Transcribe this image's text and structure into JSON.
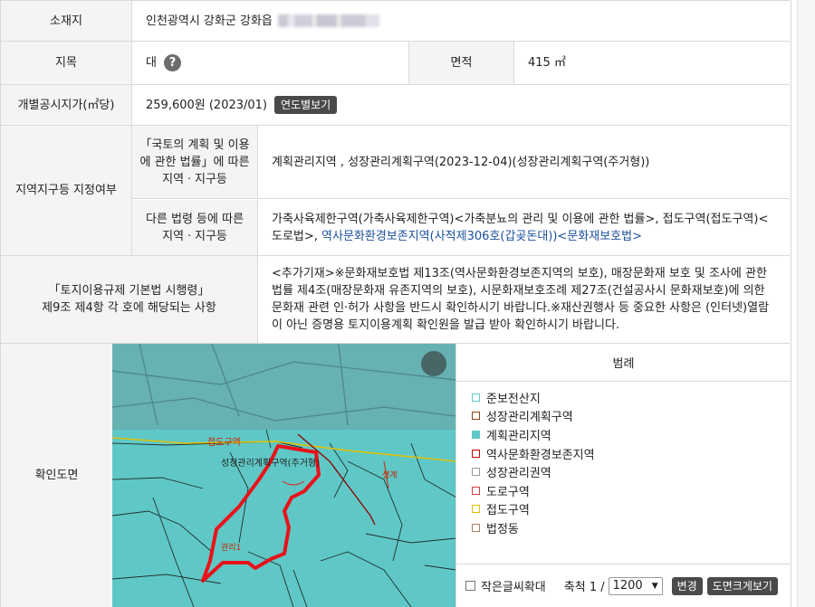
{
  "location": {
    "label": "소재지",
    "value": "인천광역시 강화군 강화읍"
  },
  "land_category": {
    "label": "지목",
    "value": "대",
    "help": "?"
  },
  "area": {
    "label": "면적",
    "value": "415 ㎡"
  },
  "official_price": {
    "label": "개별공시지가(㎡당)",
    "value": "259,600원 (2023/01)",
    "button": "연도별보기"
  },
  "zoning": {
    "label": "지역지구등 지정여부",
    "national": {
      "label": "「국토의 계획 및 이용에 관한 법률」에 따른 지역ㆍ지구등",
      "value": "계획관리지역 , 성장관리계획구역(2023-12-04)(성장관리계획구역(주거형))"
    },
    "other": {
      "label": "다른 법령 등에 따른 지역ㆍ지구등",
      "value_plain": "가축사육제한구역(가축사육제한구역)<가축분뇨의 관리 및 이용에 관한 법률>, 접도구역(접도구역)<도로법>, ",
      "value_link": "역사문화환경보존지역(사적제306호(갑곶돈대))<문화재보호법>"
    }
  },
  "enforcement": {
    "label_line1": "「토지이용규제 기본법 시행령」",
    "label_line2": "제9조 제4항 각 호에 해당되는 사항",
    "value": "<추가기재>※문화재보호법 제13조(역사문화환경보존지역의 보호), 매장문화재 보호 및 조사에 관한 법률 제4조(매장문화재 유존지역의 보호), 시문화재보호조례 제27조(건설공사시 문화재보호)에 의한 문화재 관련 인·허가 사항을 반드시 확인하시기 바랍니다.※재산권행사 등 중요한 사항은 (인터넷)열람이 아닌 증명용 토지이용계획 확인원을 발급 받아 확인하시기 바랍니다."
  },
  "map": {
    "label": "확인도면",
    "map_labels": {
      "road_zone": "접도구역",
      "growth_zone": "성장관리계획구역(주거형)",
      "small1": "생계",
      "small2": "관리1"
    },
    "legend_title": "범례",
    "legend": [
      {
        "name": "준보전산지",
        "border": "#5fc8c6",
        "fill": "#ffffff"
      },
      {
        "name": "성장관리계획구역",
        "border": "#8b4513",
        "fill": "#ffffff"
      },
      {
        "name": "계획관리지역",
        "border": "#5fc8c6",
        "fill": "#5fc8c6"
      },
      {
        "name": "역사문화환경보존지역",
        "border": "#cc0000",
        "fill": "#ffffff"
      },
      {
        "name": "성장관리권역",
        "border": "#999999",
        "fill": "#ffffff"
      },
      {
        "name": "도로구역",
        "border": "#d04040",
        "fill": "#ffffff"
      },
      {
        "name": "접도구역",
        "border": "#e6c000",
        "fill": "#ffffff"
      },
      {
        "name": "법정동",
        "border": "#b08060",
        "fill": "#ffffff"
      }
    ],
    "large_text_label": "작은글씨확대",
    "scale_label": "축척 1 /",
    "scale_value": "1200",
    "change_button": "변경",
    "enlarge_button": "도면크게보기"
  }
}
